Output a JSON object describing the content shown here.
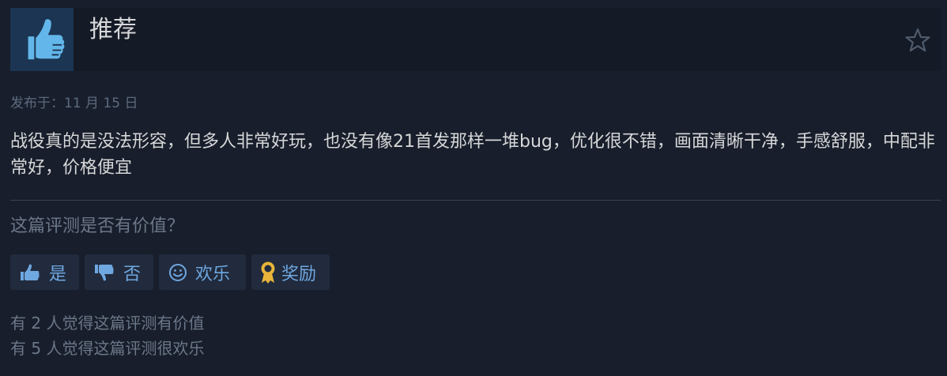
{
  "review": {
    "recommendation": "推荐",
    "posted": "发布于：11 月 15 日",
    "text": "战役真的是没法形容，但多人非常好玩，也没有像21首发那样一堆bug，优化很不错，画面清晰干净，手感舒服，中配非常好，价格便宜"
  },
  "feedback": {
    "question": "这篇评测是否有价值？",
    "buttons": {
      "yes": "是",
      "no": "否",
      "funny": "欢乐",
      "award": "奖励"
    },
    "helpful_count": "有 2 人觉得这篇评测有价值",
    "funny_count": "有 5 人觉得这篇评测很欢乐"
  },
  "icons": {
    "recommend": "thumbs-up-icon",
    "favorite": "star-icon",
    "yes": "thumbs-up-icon",
    "no": "thumbs-down-icon",
    "funny": "smiley-icon",
    "award": "award-ribbon-icon"
  },
  "colors": {
    "background": "#181e2b",
    "header_bg": "#141a26",
    "thumb_bg": "#1b3552",
    "thumb_icon": "#63b6e9",
    "button_bg": "#212b3d",
    "button_text": "#6fa7e0",
    "award_gold": "#e8b53a",
    "primary_text": "#d6d7d8",
    "muted_text": "#6b7789"
  }
}
